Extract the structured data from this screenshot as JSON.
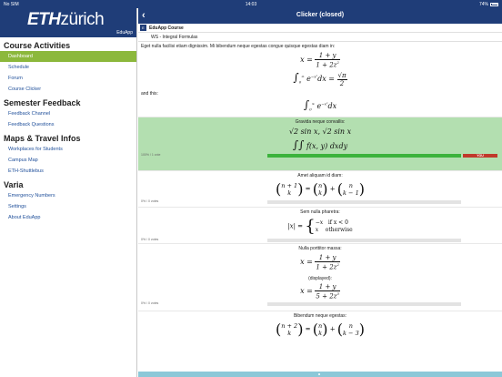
{
  "status": {
    "carrier": "No SIM",
    "time": "14:03",
    "battery": "74%"
  },
  "sidebar": {
    "logo_bold": "ETH",
    "logo_rest": "zürich",
    "app_name": "EduApp",
    "sections": [
      {
        "title": "Course Activities",
        "items": [
          "Dashboard",
          "Schedule",
          "Forum",
          "Course Clicker"
        ]
      },
      {
        "title": "Semester Feedback",
        "items": [
          "Feedback Channel",
          "Feedback Questions"
        ]
      },
      {
        "title": "Maps & Travel Infos",
        "items": [
          "Workplaces for Students",
          "Campus Map",
          "ETH-Shuttlebus"
        ]
      },
      {
        "title": "Varia",
        "items": [
          "Emergency Numbers",
          "Settings",
          "About EduApp"
        ]
      }
    ]
  },
  "nav": {
    "back": "‹",
    "title": "Clicker (closed)"
  },
  "course": {
    "icon": "E",
    "name": "EduApp Course",
    "section": "WS - Integral Formulas"
  },
  "question": {
    "text": "Eget nulla facilisi etiam dignissim. Mi bibendum neque egestas congue quisque egestas diam in:",
    "and_this": "and this:"
  },
  "options": [
    {
      "label": "Gravida neque convallis:",
      "votes": "100% / 1 vote",
      "percent": 100,
      "selected": true,
      "you": "YOU"
    },
    {
      "label": "Amet aliquam id diam:",
      "votes": "0% / 0 votes",
      "percent": 0
    },
    {
      "label": "Sem nulla pharetra:",
      "votes": "0% / 0 votes",
      "percent": 0,
      "case1": "if x < 0",
      "case2": "otherwise"
    },
    {
      "label": "Nulla porttitor massa:",
      "votes": "0% / 0 votes",
      "percent": 0,
      "displayed": "(displayed):"
    },
    {
      "label": "Bibendum neque egestas:"
    }
  ],
  "colors": {
    "brand": "#1f3d78",
    "active": "#8cb83c",
    "selected": "#b3dfb0",
    "bar_fill": "#3cb33c",
    "you": "#c0392b"
  }
}
